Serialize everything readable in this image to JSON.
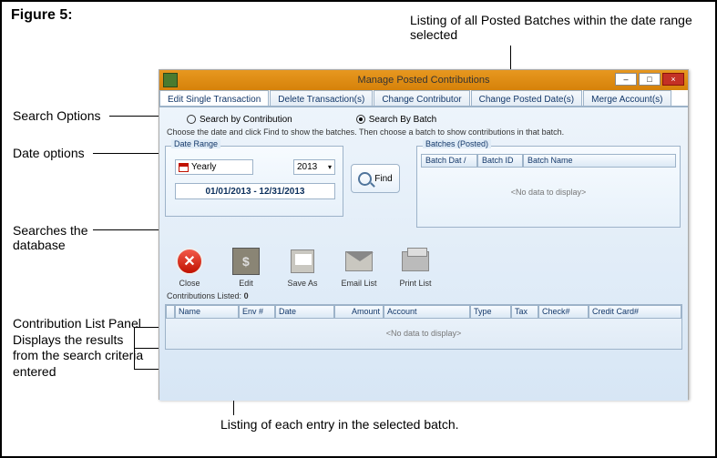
{
  "figure_label": "Figure 5:",
  "captions": {
    "batches": "Listing of all Posted Batches within the date range selected",
    "search_options": "Search Options",
    "date_options": "Date options",
    "find_desc": "Searches the database",
    "contrib_panel": "Contribution List Panel Displays the results from the search criteria entered",
    "entry_list": "Listing of each entry in the selected batch."
  },
  "window": {
    "title": "Manage Posted Contributions",
    "tabs": [
      "Edit Single Transaction",
      "Delete Transaction(s)",
      "Change Contributor",
      "Change Posted Date(s)",
      "Merge Account(s)"
    ],
    "active_tab": 0
  },
  "search": {
    "opt_contribution": "Search by Contribution",
    "opt_batch": "Search By Batch",
    "selected": "batch",
    "instruction": "Choose the date and click Find to show the batches. Then choose a batch to show contributions in that batch."
  },
  "date_range": {
    "legend": "Date Range",
    "period": "Yearly",
    "year": "2013",
    "range_text": "01/01/2013 - 12/31/2013"
  },
  "find_label": "Find",
  "batches_panel": {
    "legend": "Batches (Posted)",
    "cols": [
      "Batch Dat  /",
      "Batch ID",
      "Batch Name"
    ],
    "nodata": "<No data to display>"
  },
  "toolbar": {
    "close": "Close",
    "edit": "Edit",
    "save_as": "Save As",
    "email": "Email List",
    "print": "Print List"
  },
  "contrib_list": {
    "label": "Contributions Listed:",
    "count": "0",
    "cols": [
      "Name",
      "Env #",
      "Date",
      "Amount",
      "Account",
      "Type",
      "Tax",
      "Check#",
      "Credit Card#"
    ],
    "nodata": "<No data to display>"
  }
}
